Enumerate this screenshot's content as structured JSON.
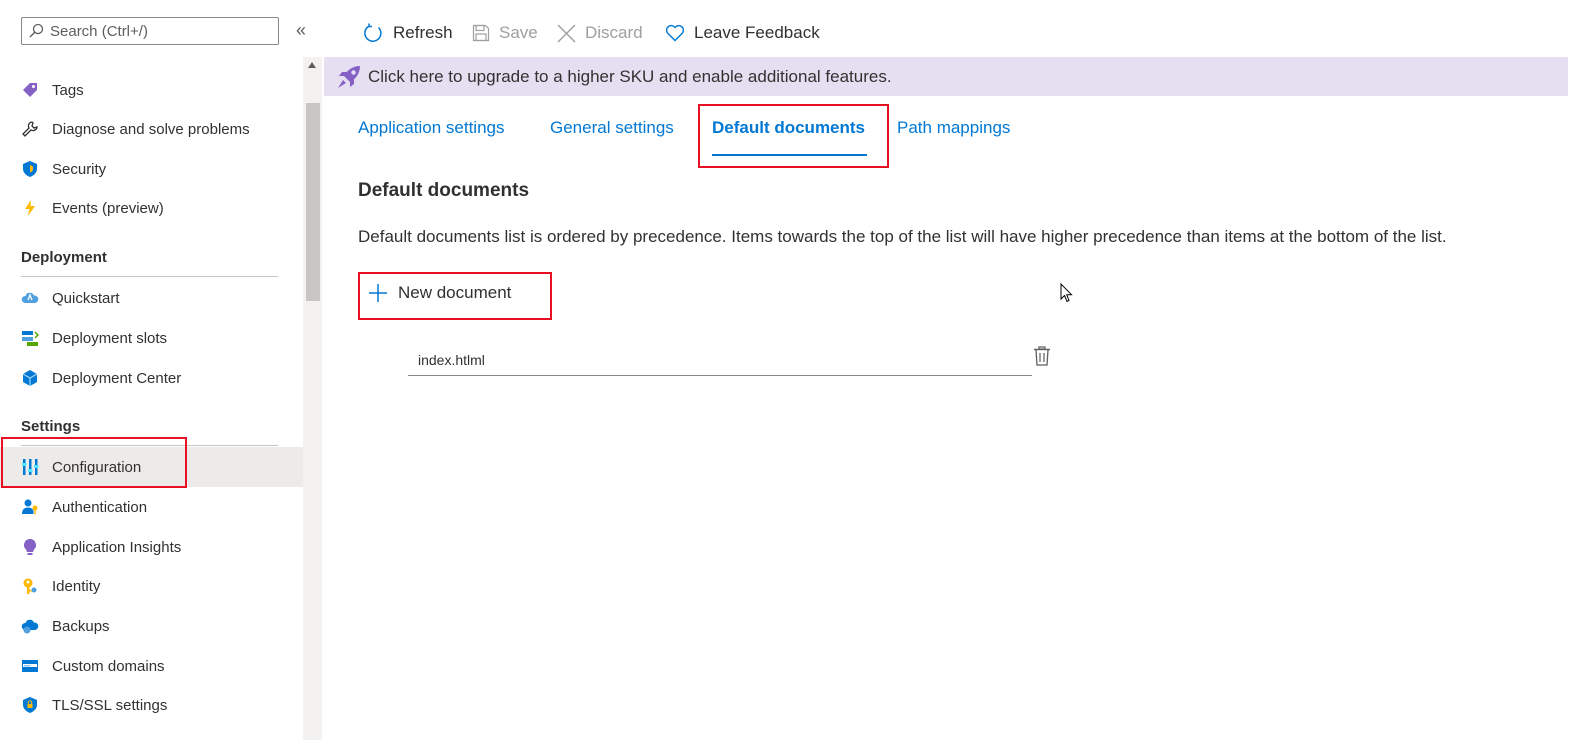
{
  "search": {
    "placeholder": "Search (Ctrl+/)"
  },
  "sidebar": {
    "collapse_glyph": "«",
    "items_top": [
      {
        "label": "Tags",
        "icon": "tag-icon"
      },
      {
        "label": "Diagnose and solve problems",
        "icon": "wrench-icon"
      },
      {
        "label": "Security",
        "icon": "shield-icon"
      },
      {
        "label": "Events (preview)",
        "icon": "lightning-icon"
      }
    ],
    "deployment_title": "Deployment",
    "deployment_items": [
      {
        "label": "Quickstart",
        "icon": "cloud-icon"
      },
      {
        "label": "Deployment slots",
        "icon": "slots-icon"
      },
      {
        "label": "Deployment Center",
        "icon": "cube-icon"
      }
    ],
    "settings_title": "Settings",
    "settings_items": [
      {
        "label": "Configuration",
        "icon": "sliders-icon",
        "selected": true
      },
      {
        "label": "Authentication",
        "icon": "person-key-icon"
      },
      {
        "label": "Application Insights",
        "icon": "lightbulb-icon"
      },
      {
        "label": "Identity",
        "icon": "key-icon"
      },
      {
        "label": "Backups",
        "icon": "cloud-backup-icon"
      },
      {
        "label": "Custom domains",
        "icon": "domain-icon"
      },
      {
        "label": "TLS/SSL settings",
        "icon": "shield-lock-icon"
      }
    ]
  },
  "toolbar": {
    "refresh": "Refresh",
    "save": "Save",
    "discard": "Discard",
    "feedback": "Leave Feedback"
  },
  "banner": {
    "text": "Click here to upgrade to a higher SKU and enable additional features."
  },
  "tabs": [
    {
      "label": "Application settings"
    },
    {
      "label": "General settings"
    },
    {
      "label": "Default documents",
      "active": true
    },
    {
      "label": "Path mappings"
    }
  ],
  "main": {
    "heading": "Default documents",
    "description": "Default documents list is ordered by precedence. Items towards the top of the list will have higher precedence than items at the bottom of the list.",
    "new_document": "New document",
    "documents": [
      "index.htlml"
    ]
  },
  "colors": {
    "accent": "#0078d4",
    "highlight": "#e81123",
    "banner_bg": "#e6dff2",
    "selected_bg": "#edebe9"
  }
}
